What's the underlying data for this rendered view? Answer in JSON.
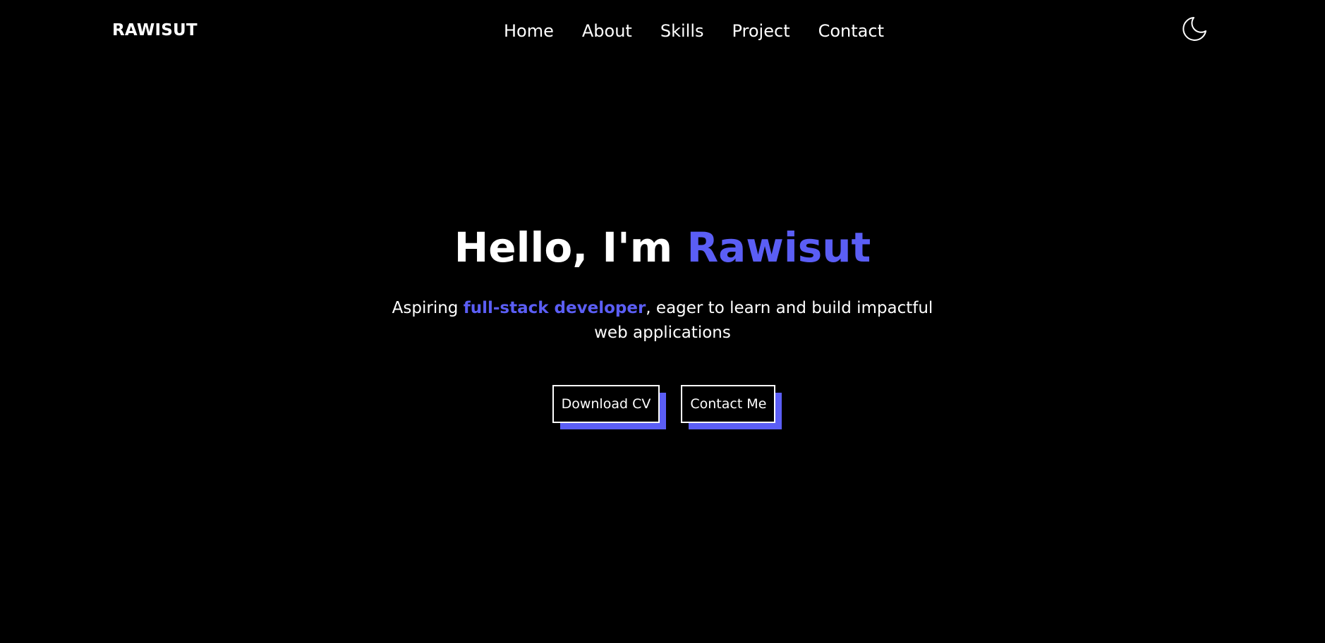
{
  "header": {
    "brand": "RAWISUT",
    "nav": [
      "Home",
      "About",
      "Skills",
      "Project",
      "Contact"
    ],
    "theme_icon": "moon-icon"
  },
  "hero": {
    "greeting": "Hello, I'm ",
    "name": "Rawisut",
    "sub_prefix": "Aspiring ",
    "sub_highlight": "full-stack developer",
    "sub_suffix": ", eager to learn and build impactful web applications",
    "buttons": {
      "download": "Download CV",
      "contact": "Contact Me"
    }
  },
  "colors": {
    "background": "#000000",
    "text": "#ffffff",
    "accent": "#5b5ef5"
  }
}
